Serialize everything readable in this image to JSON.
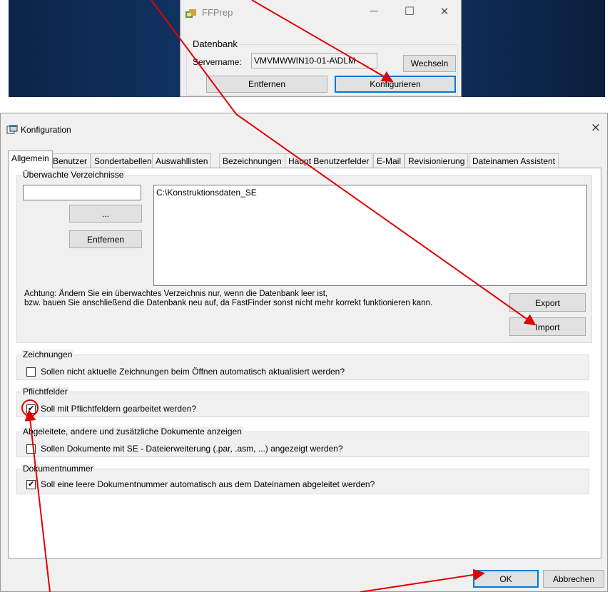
{
  "ffprep": {
    "title": "FFPrep",
    "min_glyph": "—",
    "max_glyph": "☐",
    "close_glyph": "✕",
    "group_label": "Datenbank",
    "server_label": "Servername:",
    "server_value": "VMVMWWIN10-01-A\\DLM",
    "change_button": "Wechseln",
    "remove_button": "Entfernen",
    "configure_button": "Konfigurieren"
  },
  "config": {
    "title": "Konfiguration",
    "close_glyph": "×",
    "tabs": [
      "Allgemein",
      "Benutzer",
      "Sondertabellen",
      "Auswahllisten",
      "Bezeichnungen",
      "Haupt Benutzerfelder",
      "E-Mail",
      "Revisionierung",
      "Dateinamen Assistent"
    ],
    "watched": {
      "label": "Überwachte Verzeichnisse",
      "input_value": "",
      "browse_button": "...",
      "remove_button": "Entfernen",
      "list": [
        "C:\\Konstruktionsdaten_SE"
      ],
      "warning_line1": "Achtung: Ändern Sie ein überwachtes Verzeichnis nur, wenn die Datenbank leer ist,",
      "warning_line2": "bzw. bauen Sie anschließend die Datenbank neu auf, da FastFinder sonst nicht mehr korrekt funktionieren kann.",
      "export_button": "Export",
      "import_button": "Import"
    },
    "drawings": {
      "label": "Zeichnungen",
      "option": "Sollen nicht aktuelle Zeichnungen beim Öffnen automatisch aktualisiert werden?",
      "checked": false
    },
    "required": {
      "label": "Pflichtfelder",
      "option": "Soll mit Pflichtfeldern gearbeitet werden?",
      "checked": true
    },
    "derived": {
      "label": "Abgeleitete, andere und zusätzliche Dokumente anzeigen",
      "option": "Sollen Dokumente mit SE - Dateierweiterung (.par, .asm, ...) angezeigt werden?",
      "checked": false
    },
    "docnum": {
      "label": "Dokumentnummer",
      "option": "Soll eine leere Dokumentnummer automatisch aus dem Dateinamen abgeleitet werden?",
      "checked": true
    },
    "ok_button": "OK",
    "cancel_button": "Abbrechen"
  },
  "annotation_color": "#e00000"
}
